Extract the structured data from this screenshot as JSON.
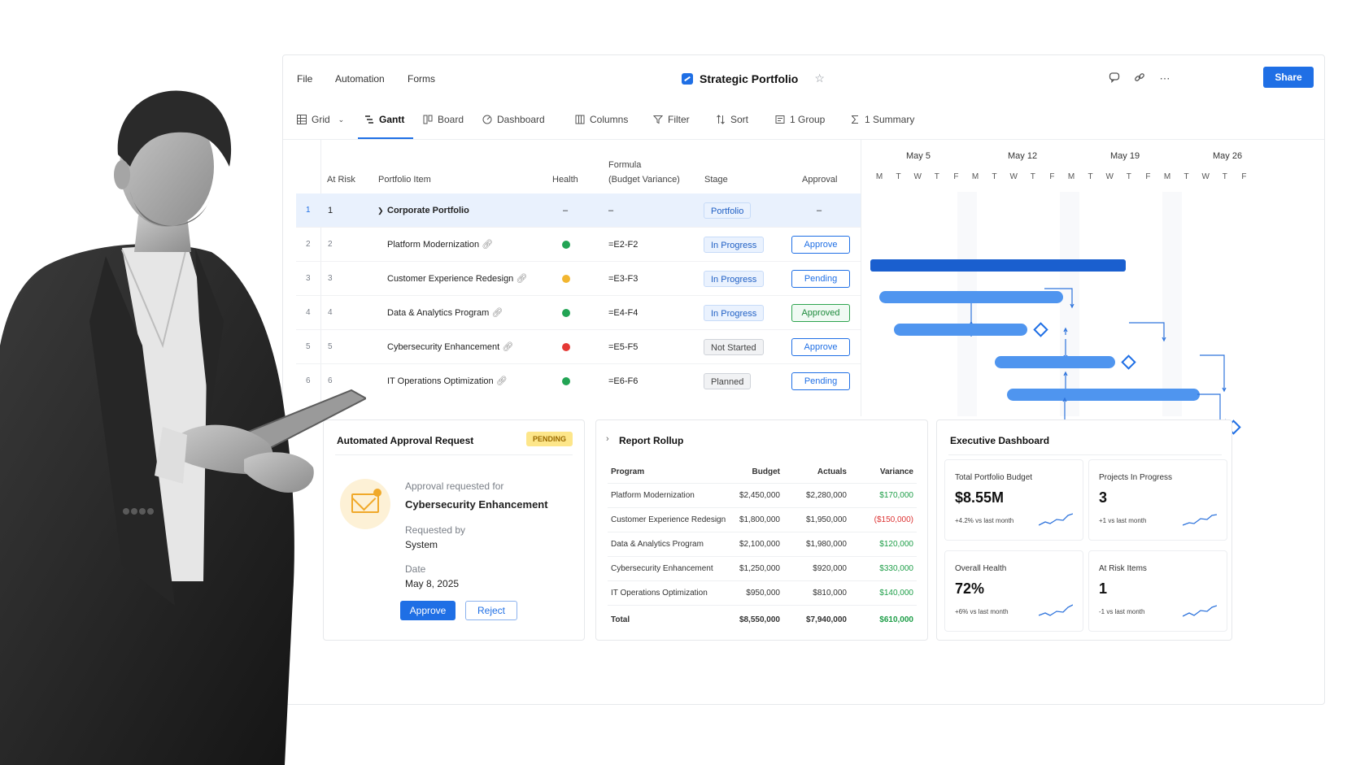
{
  "menu": [
    "File",
    "Automation",
    "Forms"
  ],
  "doc_title": "Strategic Portfolio",
  "share_label": "Share",
  "toolbar": {
    "grid": "Grid",
    "gantt": "Gantt",
    "board": "Board",
    "dashboard": "Dashboard",
    "columns": "Columns",
    "filter": "Filter",
    "sort": "Sort",
    "group": "1 Group",
    "summary": "1 Summary"
  },
  "grid": {
    "headers": {
      "at_risk": "At Risk",
      "item": "Portfolio Item",
      "health": "Health",
      "formula1": "Formula",
      "formula2": "(Budget Variance)",
      "stage": "Stage",
      "approval": "Approval"
    },
    "rows": [
      {
        "n": "1",
        "risk": "1",
        "item": "Corporate Portfolio",
        "health": "–",
        "formula": "–",
        "stage": "Portfolio",
        "approval": "–"
      },
      {
        "n": "2",
        "risk": "2",
        "item": "Platform Modernization",
        "health_color": "#22a454",
        "formula": "=E2-F2",
        "stage": "In Progress",
        "approval": "Approve"
      },
      {
        "n": "3",
        "risk": "3",
        "item": "Customer Experience Redesign",
        "health_color": "#f2b630",
        "formula": "=E3-F3",
        "stage": "In Progress",
        "approval": "Pending"
      },
      {
        "n": "4",
        "risk": "4",
        "item": "Data & Analytics Program",
        "health_color": "#22a454",
        "formula": "=E4-F4",
        "stage": "In Progress",
        "approval": "Approved"
      },
      {
        "n": "5",
        "risk": "5",
        "item": "Cybersecurity Enhancement",
        "health_color": "#e53935",
        "formula": "=E5-F5",
        "stage": "Not Started",
        "approval": "Approve"
      },
      {
        "n": "6",
        "risk": "6",
        "item": "IT Operations Optimization",
        "health_color": "#22a454",
        "formula": "=E6-F6",
        "stage": "Planned",
        "approval": "Pending"
      }
    ]
  },
  "gantt": {
    "weeks": [
      "May 5",
      "May 12",
      "May 19",
      "May 26"
    ],
    "days": [
      "M",
      "T",
      "W",
      "T",
      "F",
      "M",
      "T",
      "W",
      "T",
      "F",
      "M",
      "T",
      "W",
      "T",
      "F",
      "M",
      "T",
      "W",
      "T",
      "F"
    ]
  },
  "approval_card": {
    "title": "Automated Approval Request",
    "badge": "PENDING",
    "req_for_label": "Approval requested for",
    "req_for_value": "Cybersecurity Enhancement",
    "by_label": "Requested by",
    "by_value": "System",
    "date_label": "Date",
    "date_value": "May 8, 2025",
    "approve": "Approve",
    "reject": "Reject"
  },
  "rollup": {
    "title": "Report Rollup",
    "headers": [
      "Program",
      "Budget",
      "Actuals",
      "Variance"
    ],
    "rows": [
      [
        "Platform Modernization",
        "$2,450,000",
        "$2,280,000",
        "$170,000"
      ],
      [
        "Customer Experience Redesign",
        "$1,800,000",
        "$1,950,000",
        "($150,000)"
      ],
      [
        "Data & Analytics Program",
        "$2,100,000",
        "$1,980,000",
        "$120,000"
      ],
      [
        "Cybersecurity Enhancement",
        "$1,250,000",
        "$920,000",
        "$330,000"
      ],
      [
        "IT Operations Optimization",
        "$950,000",
        "$810,000",
        "$140,000"
      ]
    ],
    "total": [
      "Total",
      "$8,550,000",
      "$7,940,000",
      "$610,000"
    ]
  },
  "exec": {
    "title": "Executive Dashboard",
    "kpis": [
      {
        "label": "Total Portfolio Budget",
        "value": "$8.55M",
        "sub": "+4.2% vs last month"
      },
      {
        "label": "Projects In Progress",
        "value": "3",
        "sub": "+1 vs last month"
      },
      {
        "label": "Overall Health",
        "value": "72%",
        "sub": "+6% vs last month"
      },
      {
        "label": "At Risk Items",
        "value": "1",
        "sub": "-1 vs last month"
      }
    ]
  },
  "colors": {
    "accent": "#1f6fe5",
    "positive": "#1e9e48",
    "negative": "#dd3333"
  }
}
